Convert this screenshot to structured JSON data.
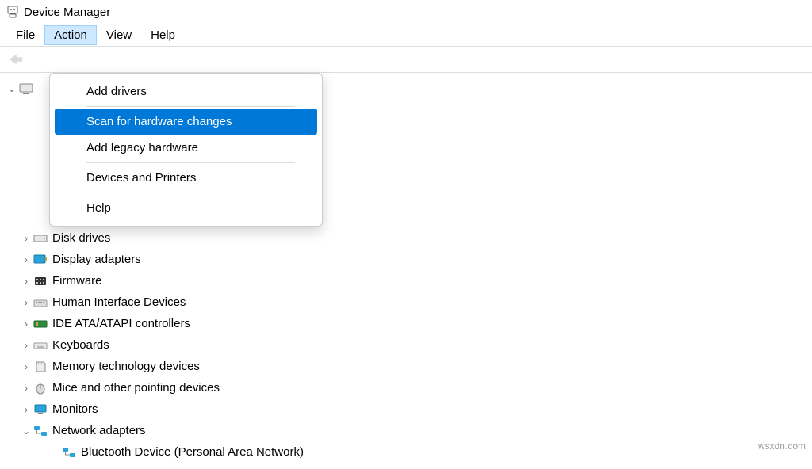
{
  "title": "Device Manager",
  "menubar": {
    "file": "File",
    "action": "Action",
    "view": "View",
    "help": "Help"
  },
  "dropdown": {
    "add_drivers": "Add drivers",
    "scan_hw": "Scan for hardware changes",
    "add_legacy": "Add legacy hardware",
    "dev_printers": "Devices and Printers",
    "help": "Help"
  },
  "tree": {
    "root": "",
    "items": [
      {
        "label": "Disk drives"
      },
      {
        "label": "Display adapters"
      },
      {
        "label": "Firmware"
      },
      {
        "label": "Human Interface Devices"
      },
      {
        "label": "IDE ATA/ATAPI controllers"
      },
      {
        "label": "Keyboards"
      },
      {
        "label": "Memory technology devices"
      },
      {
        "label": "Mice and other pointing devices"
      },
      {
        "label": "Monitors"
      },
      {
        "label": "Network adapters",
        "expanded": true,
        "children": [
          {
            "label": "Bluetooth Device (Personal Area Network)"
          }
        ]
      }
    ]
  },
  "watermark": "wsxdn.com"
}
